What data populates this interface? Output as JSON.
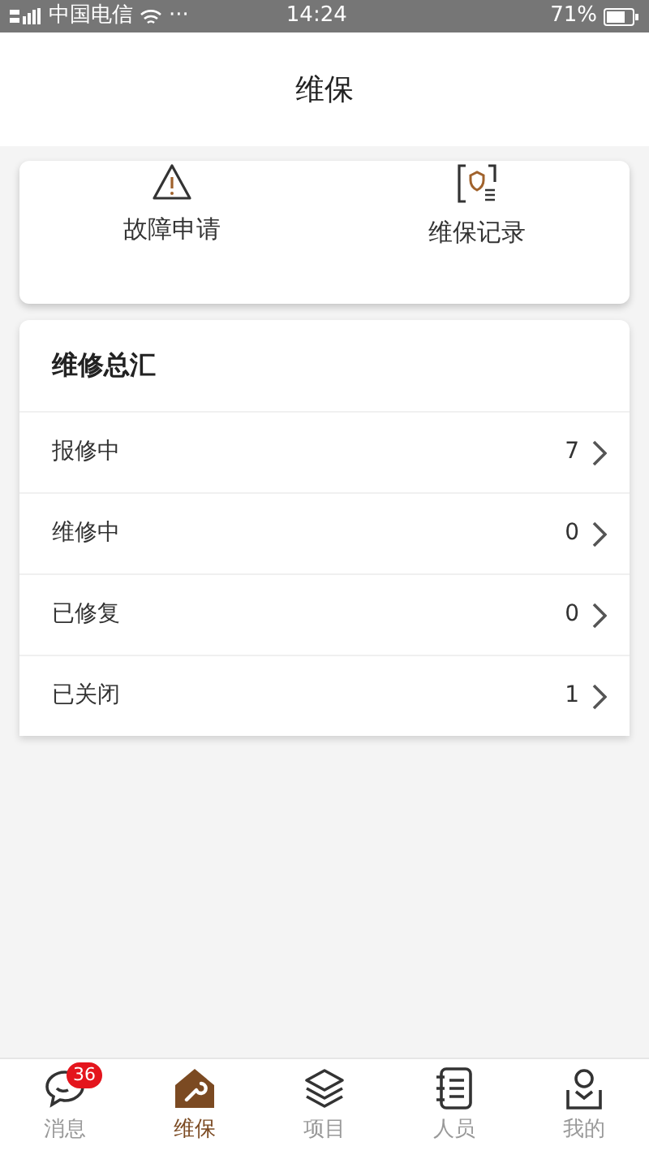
{
  "status_bar": {
    "carrier": "中国电信",
    "more": "···",
    "time": "14:24",
    "battery": "71%"
  },
  "header": {
    "title": "维保"
  },
  "quick_actions": [
    {
      "kind": "warning",
      "label": "故障申请"
    },
    {
      "kind": "record",
      "label": "维保记录"
    }
  ],
  "summary": {
    "title": "维修总汇",
    "rows": [
      {
        "label": "报修中",
        "count": "7"
      },
      {
        "label": "维修中",
        "count": "0"
      },
      {
        "label": "已修复",
        "count": "0"
      },
      {
        "label": "已关闭",
        "count": "1"
      }
    ]
  },
  "tab_bar": [
    {
      "kind": "chat",
      "label": "消息",
      "badge": "36",
      "selected": false
    },
    {
      "kind": "home",
      "label": "维保",
      "selected": true
    },
    {
      "kind": "layers",
      "label": "项目",
      "selected": false
    },
    {
      "kind": "notebook",
      "label": "人员",
      "selected": false
    },
    {
      "kind": "user",
      "label": "我的",
      "selected": false
    }
  ]
}
